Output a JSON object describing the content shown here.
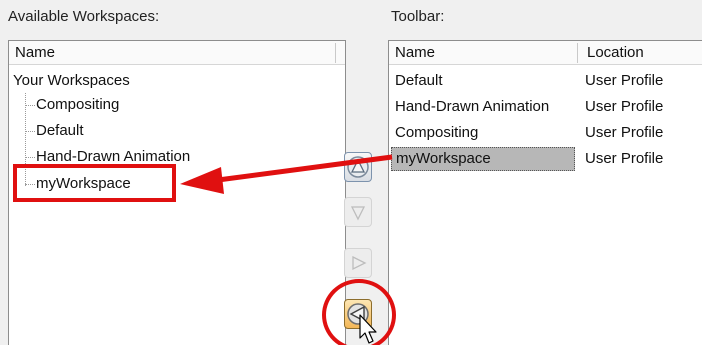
{
  "available": {
    "label": "Available Workspaces:",
    "column_header": "Name",
    "root": "Your Workspaces",
    "items": [
      "Compositing",
      "Default",
      "Hand-Drawn Animation",
      "myWorkspace"
    ]
  },
  "toolbar": {
    "label": "Toolbar:",
    "columns": [
      "Name",
      "Location"
    ],
    "rows": [
      {
        "name": "Default",
        "location": "User Profile"
      },
      {
        "name": "Hand-Drawn Animation",
        "location": "User Profile"
      },
      {
        "name": "Compositing",
        "location": "User Profile"
      },
      {
        "name": "myWorkspace",
        "location": "User Profile"
      }
    ],
    "selected_row": "myWorkspace"
  },
  "buttons": [
    {
      "icon": "move-up-icon",
      "state": "enabled"
    },
    {
      "icon": "move-down-icon",
      "state": "disabled"
    },
    {
      "icon": "add-to-toolbar-icon",
      "state": "disabled"
    },
    {
      "icon": "remove-from-toolbar-icon",
      "state": "pressed"
    }
  ],
  "colors": {
    "annotation": "#e01010",
    "selection": "#b7b7b7",
    "pressed_button": "#f3b757"
  }
}
